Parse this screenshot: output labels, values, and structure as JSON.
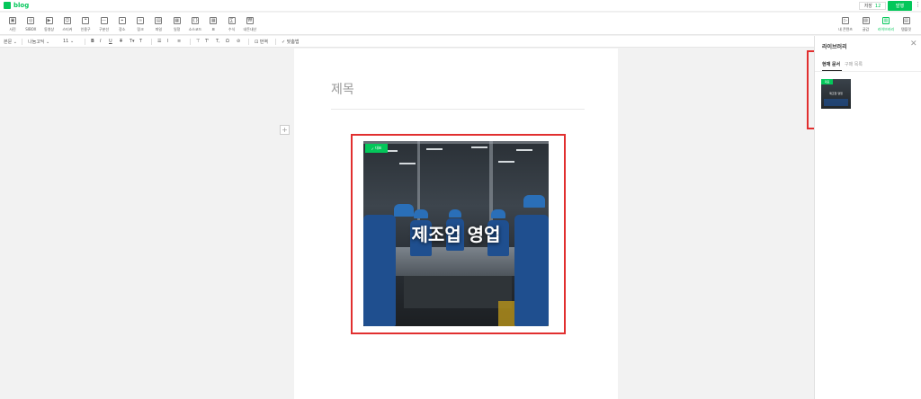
{
  "app": {
    "logo_text": "blog",
    "brand_color": "#03c75a",
    "highlight_color": "#e12f2f"
  },
  "header": {
    "save_label": "저장",
    "save_count": "12",
    "publish_label": "발행",
    "more_icon": "more-vertical-icon"
  },
  "toolbar_left": [
    {
      "label": "사진",
      "icon": "photo-icon"
    },
    {
      "label": "SIBOX",
      "icon": "sibox-icon"
    },
    {
      "label": "동영상",
      "icon": "video-icon"
    },
    {
      "label": "스티커",
      "icon": "sticker-icon"
    },
    {
      "label": "인용구",
      "icon": "quote-icon"
    },
    {
      "label": "구분선",
      "icon": "divider-icon"
    },
    {
      "label": "장소",
      "icon": "location-icon"
    },
    {
      "label": "링크",
      "icon": "link-icon"
    },
    {
      "label": "파일",
      "icon": "file-icon"
    },
    {
      "label": "일정",
      "icon": "calendar-icon"
    },
    {
      "label": "소스코드",
      "icon": "code-icon"
    },
    {
      "label": "표",
      "icon": "table-icon"
    },
    {
      "label": "수식",
      "icon": "formula-icon"
    },
    {
      "label": "내돈내산",
      "icon": "purchase-icon"
    }
  ],
  "toolbar_right": [
    {
      "label": "내 콘텐츠",
      "icon": "my-content-icon"
    },
    {
      "label": "글감",
      "icon": "material-icon"
    },
    {
      "label": "라이브러리",
      "icon": "library-icon",
      "active": true
    },
    {
      "label": "템플릿",
      "icon": "template-icon"
    }
  ],
  "formatbar": {
    "style": "본문",
    "font": "나눔고딕",
    "size": "11",
    "translate": "번역",
    "spellcheck": "맞춤법"
  },
  "editor": {
    "title_placeholder": "제목",
    "add_button": "+"
  },
  "image": {
    "caption": "제조업 영업",
    "badge": "대표"
  },
  "library": {
    "title": "라이브러리",
    "tabs": [
      {
        "label": "현재 문서",
        "active": true
      },
      {
        "label": "구매 목록",
        "active": false
      }
    ],
    "items": [
      {
        "badge": "대표",
        "caption": "제조업 영업"
      }
    ]
  }
}
